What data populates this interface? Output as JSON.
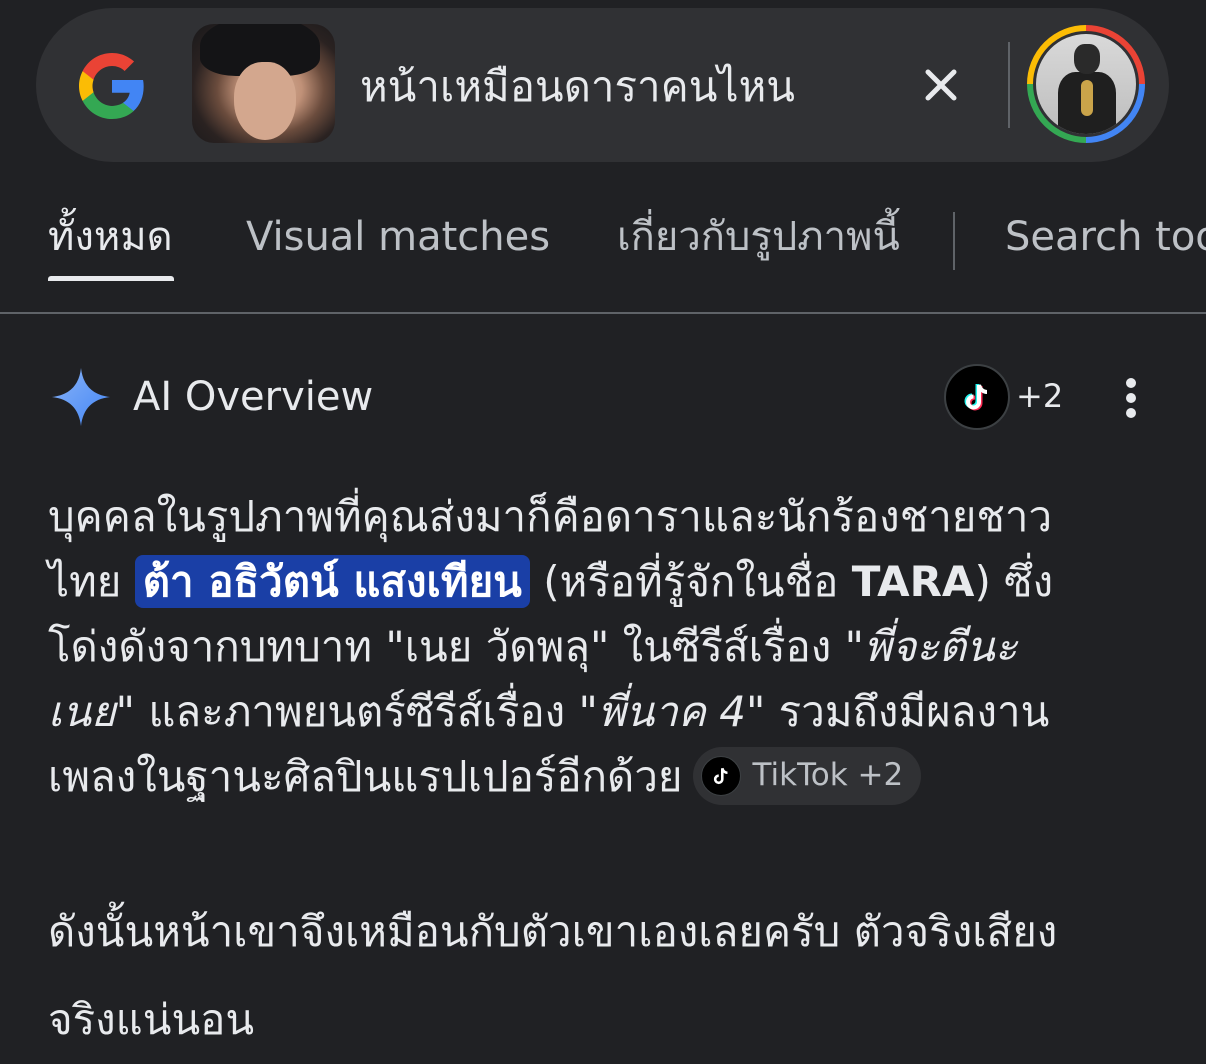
{
  "search": {
    "query": "หน้าเหมือนดาราคนไหน",
    "clear_icon": "close-icon",
    "logo_icon": "google-g-icon"
  },
  "tabs": [
    {
      "label": "ทั้งหมด",
      "active": true
    },
    {
      "label": "Visual matches",
      "active": false
    },
    {
      "label": "เกี่ยวกับรูปภาพนี้",
      "active": false
    },
    {
      "label": "Search tools",
      "active": false
    }
  ],
  "ai_overview": {
    "title": "AI Overview",
    "source_count": "+2",
    "source_icon": "tiktok-icon",
    "paragraph1": {
      "l1": "บุคคลในรูปภาพที่คุณส่งมาก็คือดาราและนักร้องชายชาว",
      "l2_a": "ไทย ",
      "l2_name": "ต้า อธิวัตน์ แสงเทียน",
      "l2_b": " (หรือที่รู้จักในชื่อ ",
      "l2_bold": "TARA",
      "l2_c": ") ซึ่ง",
      "l3_a": "โด่งดังจากบทบาท \"เนย วัดพลุ\" ในซีรีส์เรื่อง ",
      "l3_ital": "\"พี่จะตีนะ",
      "l4_ital1": "เนย\"",
      "l4_a": " และภาพยนตร์ซีรีส์เรื่อง ",
      "l4_ital2": "\"พี่นาค 4\"",
      "l4_b": " รวมถึงมีผลงาน",
      "l5": "เพลงในฐานะศิลปินแรปเปอร์อีกด้วย",
      "chip_label": "TikTok +2"
    },
    "paragraph2": {
      "l1": "ดังนั้นหน้าเขาจึงเหมือนกับตัวเขาเองเลยครับ ตัวจริงเสียง",
      "l2": "จริงแน่นอน"
    }
  },
  "colors": {
    "background": "#202124",
    "search_bar": "#303134",
    "highlight": "#1a3fa6",
    "text": "#e8eaed",
    "muted": "#bdc1c6"
  }
}
